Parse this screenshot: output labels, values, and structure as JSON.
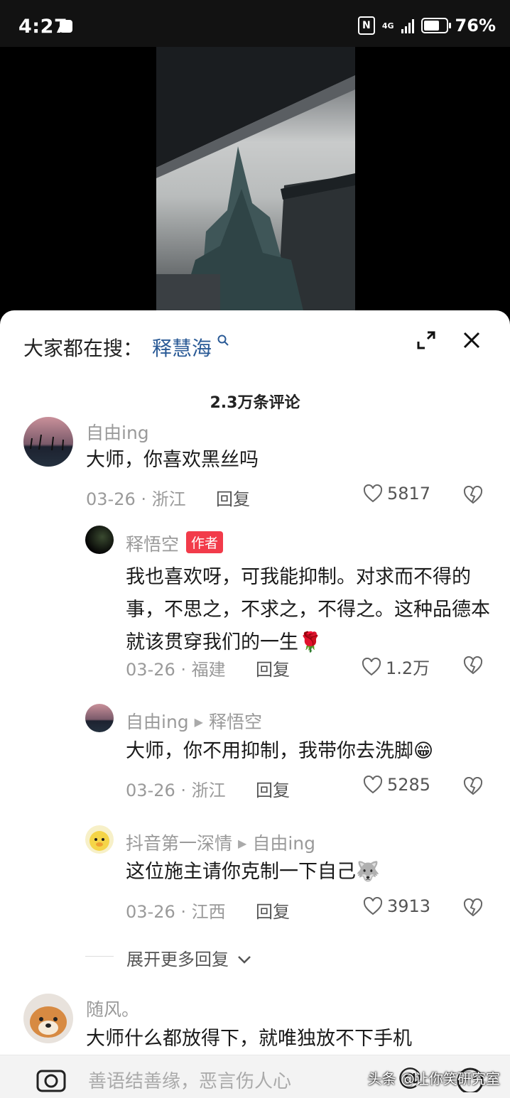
{
  "status_bar": {
    "time": "4:27",
    "battery": "76%",
    "battery_level": 0.76,
    "network": "4G"
  },
  "search": {
    "label": "大家都在搜：",
    "term": "释慧海"
  },
  "comments_count": "2.3万条评论",
  "comments": [
    {
      "name": "自由ing",
      "text": "大师，你喜欢黑丝吗",
      "date": "03-26",
      "location": "浙江",
      "reply": "回复",
      "likes": "5817"
    },
    {
      "name": "释悟空",
      "badge": "作者",
      "text": "我也喜欢呀，可我能抑制。对求而不得的事，不思之，不求之，不得之。这种品德本就该贯穿我们的一生🌹",
      "date": "03-26",
      "location": "福建",
      "reply": "回复",
      "likes": "1.2万"
    },
    {
      "name": "自由ing",
      "reply_to": "释悟空",
      "text": "大师，你不用抑制，我带你去洗脚😁",
      "date": "03-26",
      "location": "浙江",
      "reply": "回复",
      "likes": "5285"
    },
    {
      "name": "抖音第一深情",
      "reply_to": "自由ing",
      "text": "这位施主请你克制一下自己🐺",
      "date": "03-26",
      "location": "江西",
      "reply": "回复",
      "likes": "3913"
    },
    {
      "name": "随风。",
      "text": "大师什么都放得下，就唯独放不下手机"
    }
  ],
  "expand_replies": "展开更多回复",
  "input": {
    "placeholder": "善语结善缘，恶言伤人心"
  },
  "watermark": "头条 @让你笑研究室",
  "colors": {
    "link": "#2a5a96",
    "badge": "#f23b4a"
  }
}
